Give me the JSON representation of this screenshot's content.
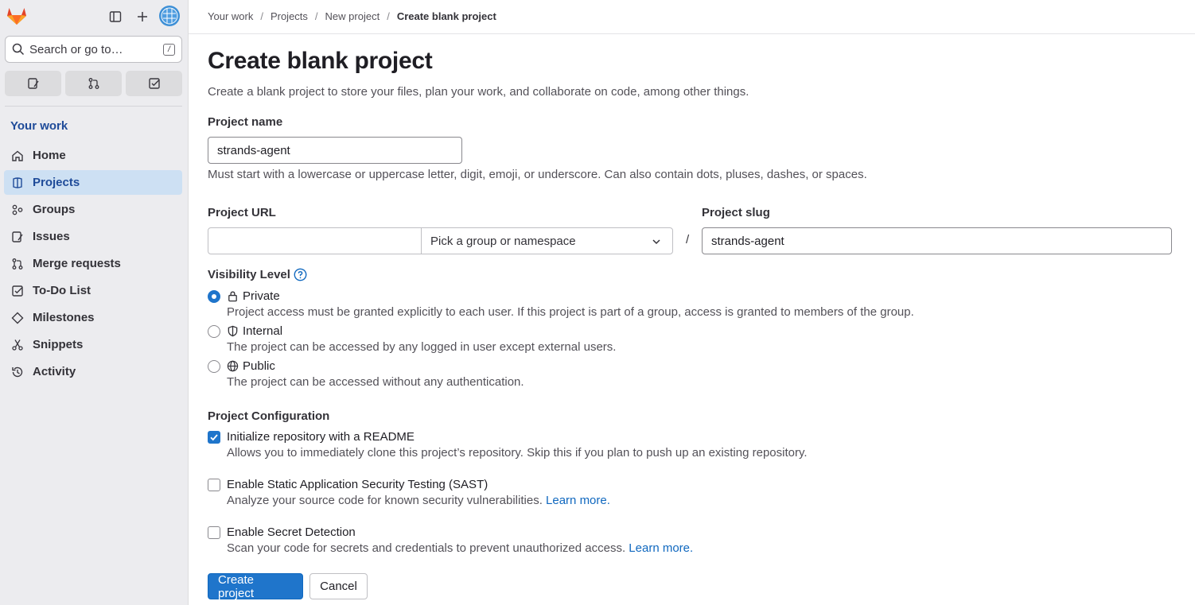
{
  "sidebar": {
    "search_placeholder": "Search or go to…",
    "search_shortcut": "/",
    "section_title": "Your work",
    "items": [
      {
        "label": "Home",
        "icon": "home-icon"
      },
      {
        "label": "Projects",
        "icon": "project-icon",
        "active": true
      },
      {
        "label": "Groups",
        "icon": "group-icon"
      },
      {
        "label": "Issues",
        "icon": "issues-icon"
      },
      {
        "label": "Merge requests",
        "icon": "merge-request-icon"
      },
      {
        "label": "To-Do List",
        "icon": "todo-icon"
      },
      {
        "label": "Milestones",
        "icon": "milestone-icon"
      },
      {
        "label": "Snippets",
        "icon": "snippet-icon"
      },
      {
        "label": "Activity",
        "icon": "history-icon"
      }
    ]
  },
  "breadcrumb": [
    "Your work",
    "Projects",
    "New project",
    "Create blank project"
  ],
  "page": {
    "title": "Create blank project",
    "description": "Create a blank project to store your files, plan your work, and collaborate on code, among other things."
  },
  "form": {
    "project_name_label": "Project name",
    "project_name_value": "strands-agent",
    "project_name_help": "Must start with a lowercase or uppercase letter, digit, emoji, or underscore. Can also contain dots, pluses, dashes, or spaces.",
    "project_url_label": "Project URL",
    "project_url_value": "",
    "namespace_placeholder": "Pick a group or namespace",
    "url_separator": "/",
    "project_slug_label": "Project slug",
    "project_slug_value": "strands-agent",
    "visibility_label": "Visibility Level",
    "visibility_options": [
      {
        "label": "Private",
        "description": "Project access must be granted explicitly to each user. If this project is part of a group, access is granted to members of the group.",
        "checked": true,
        "icon": "lock-icon"
      },
      {
        "label": "Internal",
        "description": "The project can be accessed by any logged in user except external users.",
        "checked": false,
        "icon": "shield-icon"
      },
      {
        "label": "Public",
        "description": "The project can be accessed without any authentication.",
        "checked": false,
        "icon": "globe-icon"
      }
    ],
    "config_label": "Project Configuration",
    "config_options": [
      {
        "label": "Initialize repository with a README",
        "description": "Allows you to immediately clone this project’s repository. Skip this if you plan to push up an existing repository.",
        "checked": true,
        "link": ""
      },
      {
        "label": "Enable Static Application Security Testing (SAST)",
        "description": "Analyze your source code for known security vulnerabilities.",
        "checked": false,
        "link": "Learn more."
      },
      {
        "label": "Enable Secret Detection",
        "description": "Scan your code for secrets and credentials to prevent unauthorized access.",
        "checked": false,
        "link": "Learn more."
      }
    ],
    "submit_label": "Create project",
    "cancel_label": "Cancel"
  },
  "colors": {
    "primary": "#1f75cb",
    "link": "#1068bf",
    "active_nav": "#cde0f3"
  }
}
